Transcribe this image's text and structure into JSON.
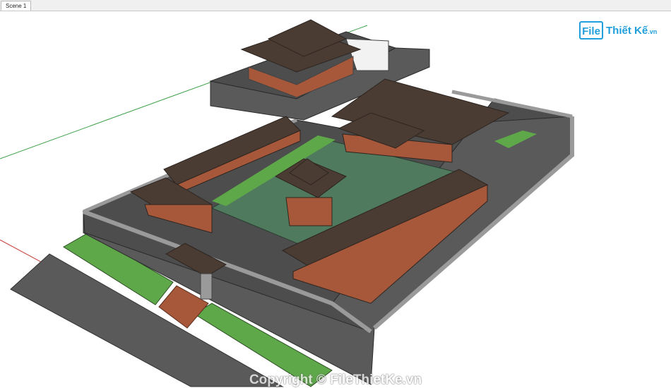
{
  "tab": {
    "label": "Scene 1"
  },
  "logo": {
    "mark": "File",
    "text": "Thiết Kế",
    "tld": ".vn"
  },
  "watermark": {
    "text": "Copyright © FileThietKe.vn"
  },
  "colors": {
    "roof": "#4a3b33",
    "roof_edge": "#2d2520",
    "wall": "#8c8c8c",
    "stone_wall": "#5a5a5a",
    "paving": "#4d4d4d",
    "pond": "#4f7a5e",
    "grass": "#5fa84a",
    "brick": "#a8583a",
    "axis_green": "#3fa24a",
    "axis_red": "#c8413a"
  },
  "icons": {
    "logo": "filethietke-logo"
  }
}
